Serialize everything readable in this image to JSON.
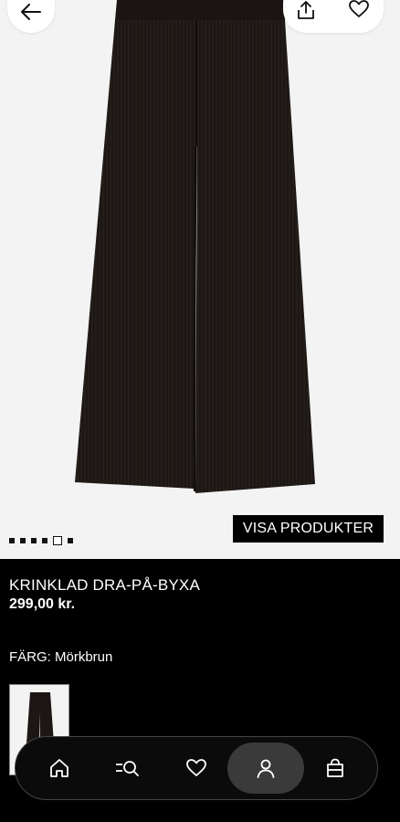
{
  "header": {
    "back_icon": "arrow-left-icon",
    "share_icon": "share-icon",
    "wishlist_icon": "heart-outline-icon"
  },
  "gallery": {
    "image_description_icon": "product-image",
    "total_images": 6,
    "active_index": 5,
    "show_products_label": "VISA PRODUKTER"
  },
  "product": {
    "title": "KRINKLAD DRA-PÅ-BYXA",
    "price": "299,00 kr.",
    "color_label": "FÄRG: Mörkbrun"
  },
  "bottom_nav": {
    "items": [
      {
        "icon": "home-icon",
        "active": false
      },
      {
        "icon": "search-menu-icon",
        "active": false
      },
      {
        "icon": "heart-icon",
        "active": false
      },
      {
        "icon": "user-icon",
        "active": true
      },
      {
        "icon": "bag-icon",
        "active": false
      }
    ]
  },
  "colors": {
    "garment": "#1c1714",
    "background": "#f3f3f3",
    "page": "#000000"
  }
}
